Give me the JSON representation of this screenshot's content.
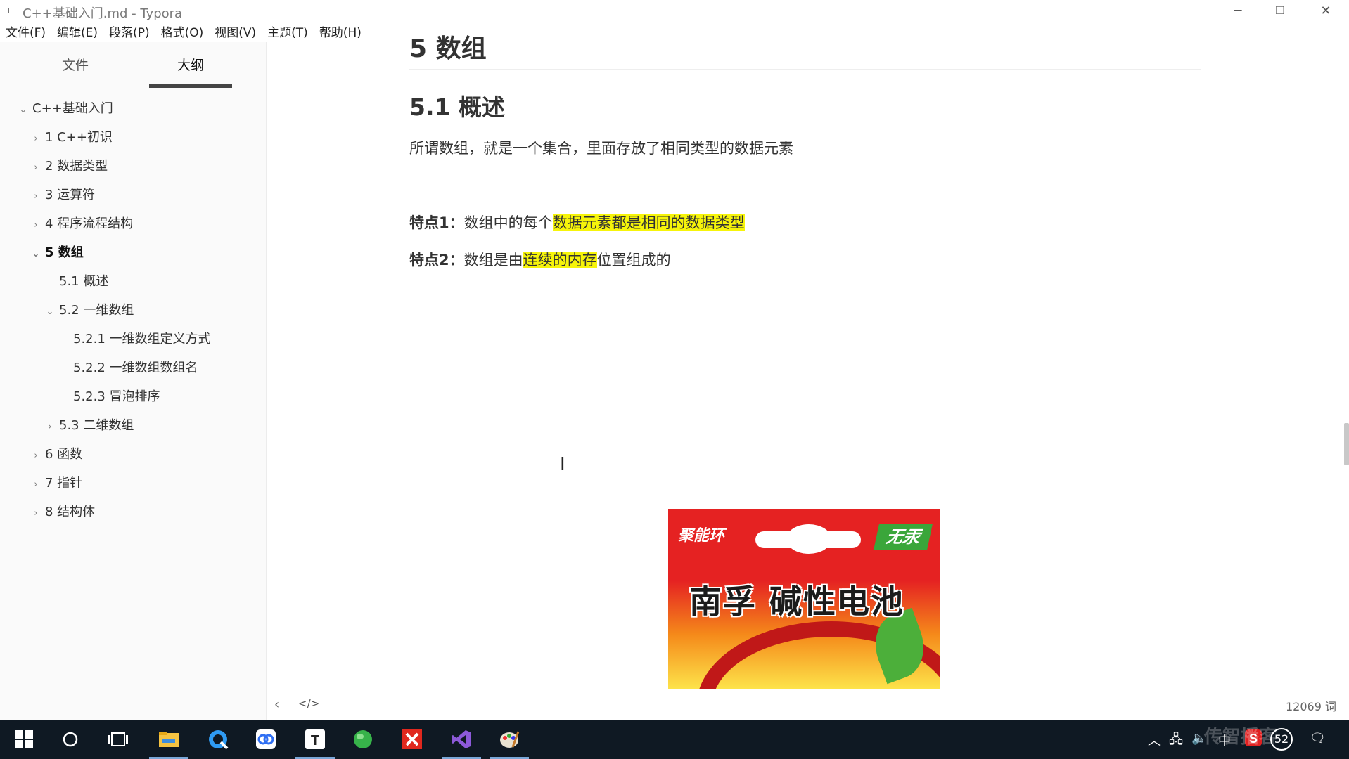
{
  "window": {
    "app_icon": "T",
    "title": "C++基础入门.md - Typora"
  },
  "menu": [
    "文件(F)",
    "编辑(E)",
    "段落(P)",
    "格式(O)",
    "视图(V)",
    "主题(T)",
    "帮助(H)"
  ],
  "sidebar": {
    "tabs": [
      {
        "label": "文件",
        "active": false
      },
      {
        "label": "大纲",
        "active": true
      }
    ],
    "outline": [
      {
        "label": "C++基础入门"
      },
      {
        "label": "1 C++初识"
      },
      {
        "label": "2 数据类型"
      },
      {
        "label": "3 运算符"
      },
      {
        "label": "4 程序流程结构"
      },
      {
        "label": "5 数组"
      },
      {
        "label": "5.1 概述"
      },
      {
        "label": "5.2 一维数组"
      },
      {
        "label": "5.2.1 一维数组定义方式"
      },
      {
        "label": "5.2.2 一维数组数组名"
      },
      {
        "label": "5.2.3 冒泡排序"
      },
      {
        "label": "5.3 二维数组"
      },
      {
        "label": "6 函数"
      },
      {
        "label": "7 指针"
      },
      {
        "label": "8 结构体"
      }
    ]
  },
  "doc": {
    "h1": "5 数组",
    "h2": "5.1 概述",
    "intro": "所谓数组，就是一个集合，里面存放了相同类型的数据元素",
    "feature1": {
      "label": "特点1：",
      "text_before": "数组中的每个",
      "highlight": "数据元素都是相同的数据类型",
      "text_after": ""
    },
    "feature2": {
      "label": "特点2：",
      "text_before": "数组是由",
      "highlight": "连续的内存",
      "text_after": "位置组成的"
    },
    "image": {
      "brand": "聚能环",
      "badge": "无汞",
      "product": "南孚 碱性电池"
    }
  },
  "status": {
    "word_count": "12069 词"
  },
  "colors": {
    "highlight": "#f6f40a",
    "taskbar": "#0f1923",
    "sidebar_bg": "#fafafa"
  },
  "taskbar": {
    "tray": {
      "ime": "中",
      "badge": "52",
      "watermark": "传智播客"
    }
  }
}
